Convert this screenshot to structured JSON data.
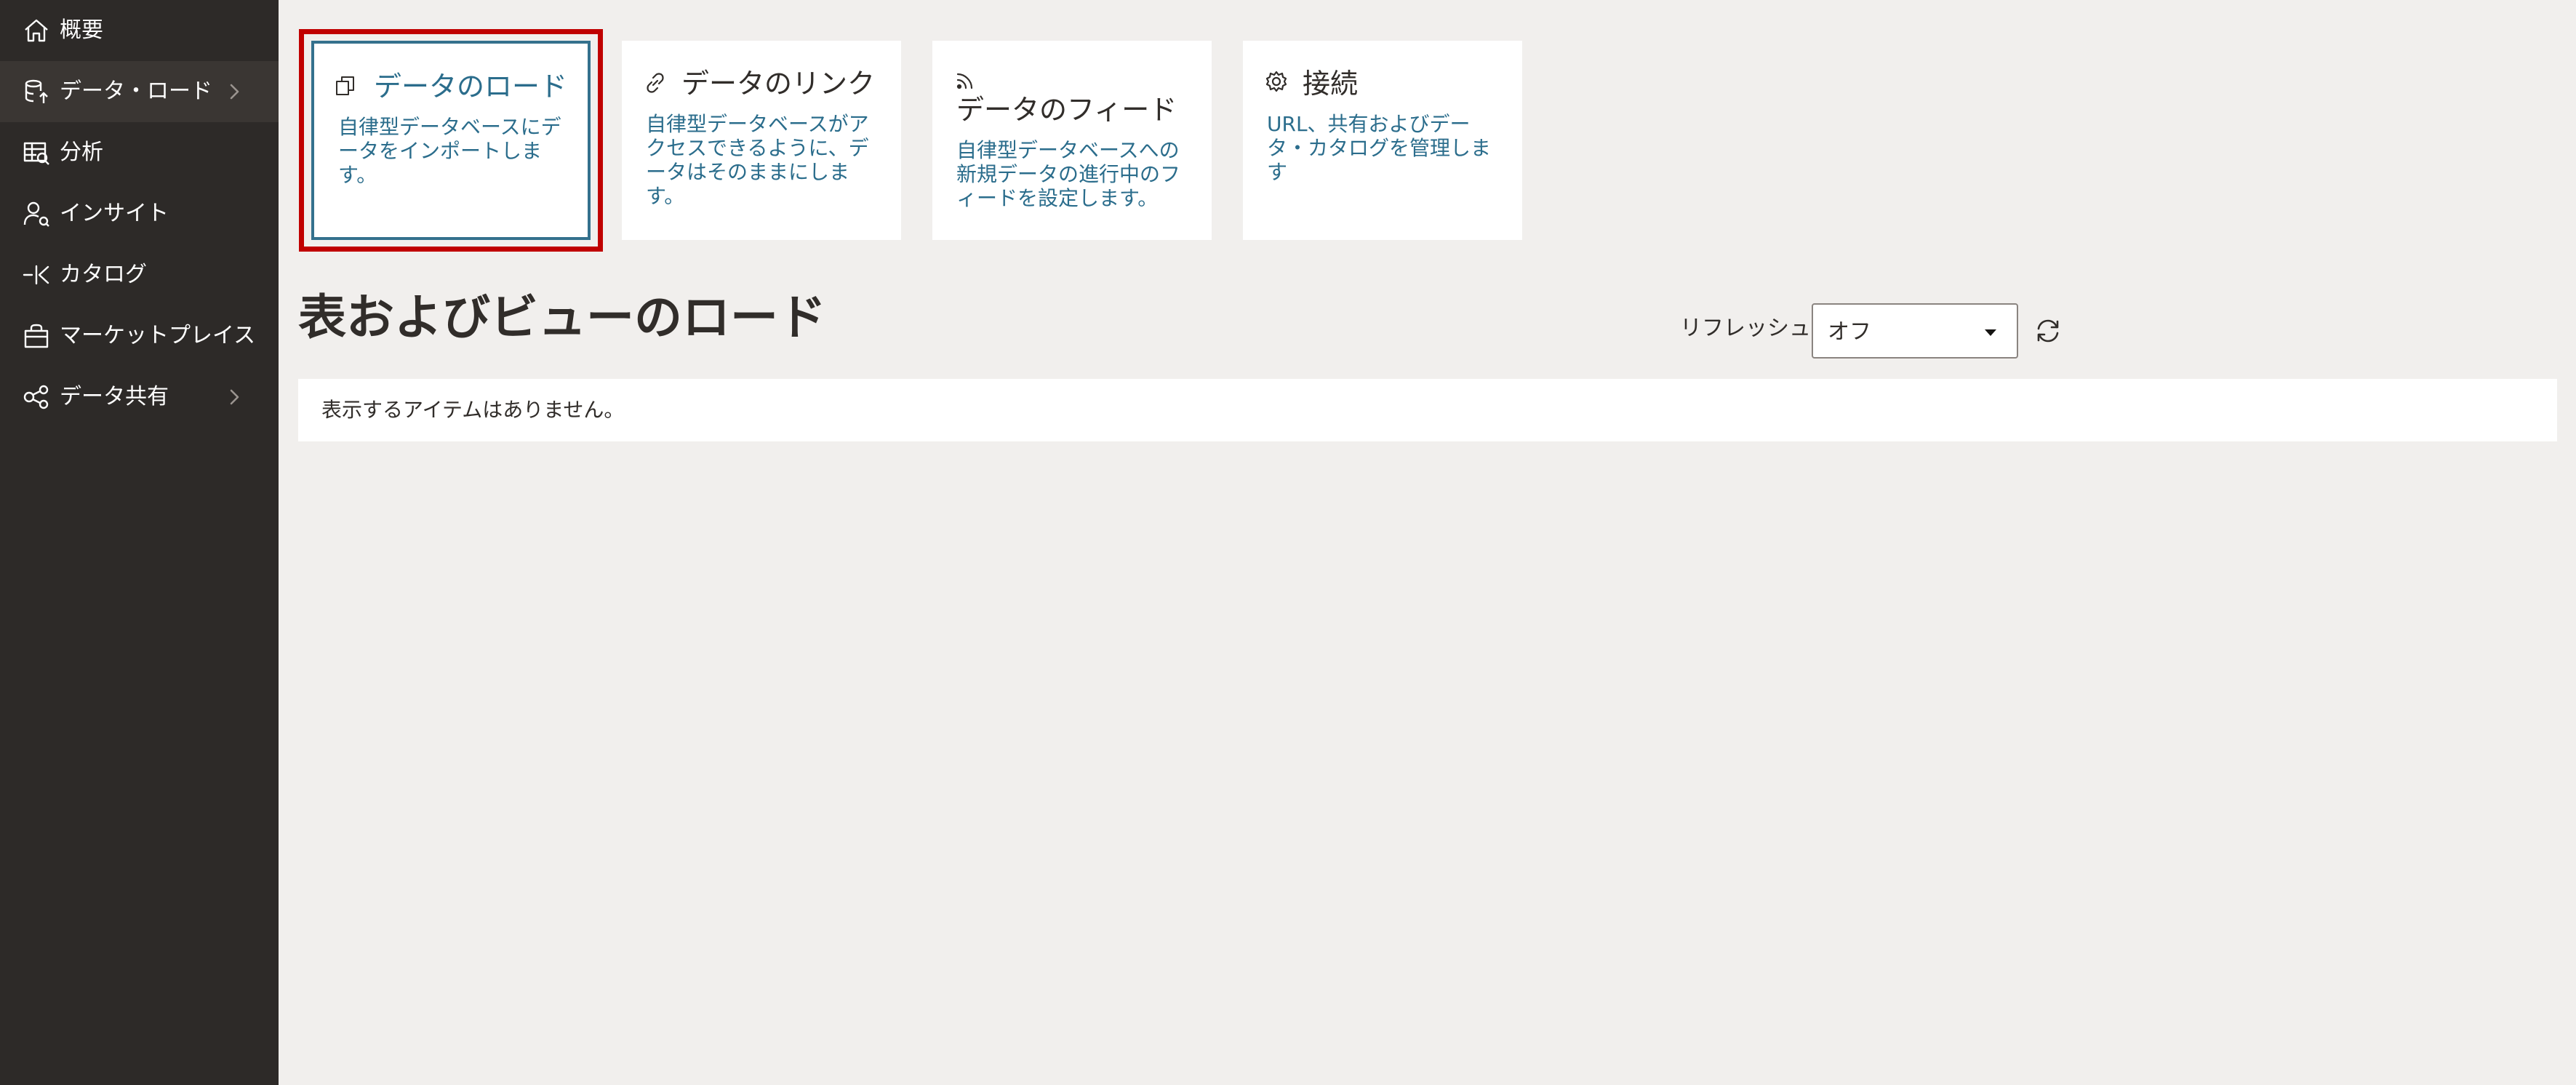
{
  "sidebar": {
    "items": [
      {
        "label": "概要",
        "icon": "home-icon"
      },
      {
        "label": "データ・ロード",
        "icon": "data-load-icon",
        "active": true
      },
      {
        "label": "分析",
        "icon": "analytics-icon"
      },
      {
        "label": "インサイト",
        "icon": "insights-icon"
      },
      {
        "label": "カタログ",
        "icon": "catalog-icon"
      },
      {
        "label": "マーケットプレイス",
        "icon": "marketplace-icon"
      },
      {
        "label": "データ共有",
        "icon": "data-share-icon"
      }
    ]
  },
  "cards": [
    {
      "title": "データのロード",
      "desc": "自律型データベースにデータをインポートします。",
      "icon": "load-copy-icon",
      "selected": true
    },
    {
      "title": "データのリンク",
      "desc": "自律型データベースがアクセスできるように、データはそのままにします。",
      "icon": "link-icon"
    },
    {
      "title": "データのフィード",
      "desc": "自律型データベースへの新規データの進行中のフィードを設定します。",
      "icon": "feed-icon"
    },
    {
      "title": "接続",
      "desc": "URL、共有およびデータ・カタログを管理します",
      "icon": "gear-icon"
    }
  ],
  "section": {
    "title": "表およびビューのロード"
  },
  "refresh": {
    "label": "リフレッシュ",
    "selected": "オフ"
  },
  "results": {
    "empty_message": "表示するアイテムはありません。"
  },
  "colors": {
    "sidebar_bg": "#2d2a28",
    "main_bg": "#f1efed",
    "accent_link": "#2b6d8c",
    "highlight": "#c00000"
  }
}
